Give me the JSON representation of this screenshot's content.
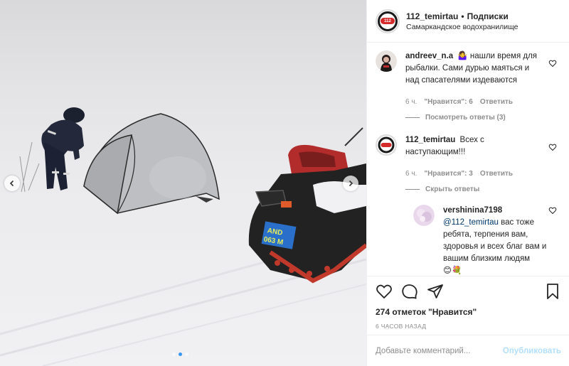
{
  "header": {
    "username": "112_temirtau",
    "separator": "•",
    "follow_label": "Подписки",
    "location": "Самаркандское водохранилище",
    "logo_text": "112"
  },
  "photo": {
    "plate_line1": "AND",
    "plate_line2": "063 M",
    "active_slide": 2,
    "slide_count": 3
  },
  "comments": [
    {
      "username": "andreev_n.a",
      "emoji": "🤷‍♀️",
      "text": "нашли время для рыбалки. Сами дурью маяться и над спасателями издеваются",
      "time": "6 ч.",
      "likes": "\"Нравится\": 6",
      "reply": "Ответить",
      "view_replies": "Посмотреть ответы (3)"
    },
    {
      "username": "112_temirtau",
      "text": "Всех с наступающим!!!",
      "time": "6 ч.",
      "likes": "\"Нравится\": 3",
      "reply": "Ответить",
      "view_replies": "Скрыть ответы"
    }
  ],
  "reply": {
    "username": "vershinina7198",
    "mention": "@112_temirtau",
    "text": "вас тоже ребята, терпения вам, здоровья и всех благ вам и вашим близким людям",
    "emojis": "😊💐"
  },
  "actions": {
    "likes_text": "274 отметок \"Нравится\"",
    "posted": "6 ЧАСОВ НАЗАД"
  },
  "add_comment": {
    "placeholder": "Добавьте комментарий...",
    "publish": "Опубликовать"
  },
  "colors": {
    "accent": "#3897f0",
    "publish_disabled": "#b2dffc",
    "muted": "#8e8e8e"
  }
}
